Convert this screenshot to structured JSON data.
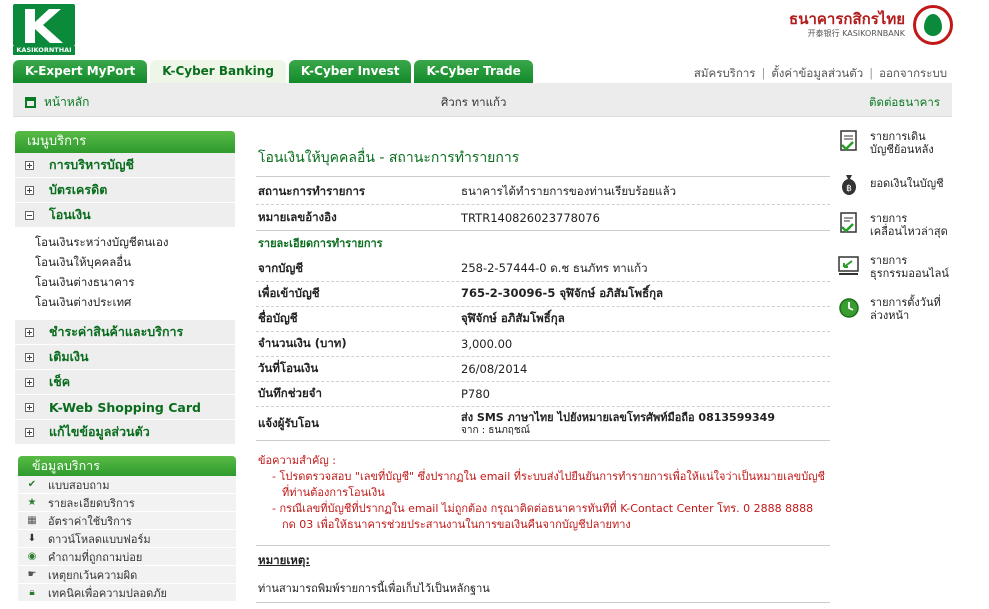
{
  "brand": {
    "logo_text": "KASIKORNTHAI",
    "bank_name_th": "ธนาคารกสิกรไทย",
    "bank_name_en": "开泰银行 KASIKORNBANK",
    "accent_green": "#0a8a3a",
    "accent_red": "#c21818"
  },
  "tabs": [
    {
      "label": "K-Expert MyPort"
    },
    {
      "label": "K-Cyber Banking"
    },
    {
      "label": "K-Cyber Invest"
    },
    {
      "label": "K-Cyber Trade"
    }
  ],
  "toplinks": {
    "register": "สมัครบริการ",
    "settings": "ตั้งค่าข้อมูลส่วนตัว",
    "logout": "ออกจากระบบ"
  },
  "subbar": {
    "home": "หน้าหลัก",
    "username": "ศิวกร ทาแก้ว",
    "contact": "ติดต่อธนาคาร"
  },
  "leftmenu": {
    "header": "เมนูบริการ",
    "items": [
      {
        "label": "การบริหารบัญชี"
      },
      {
        "label": "บัตรเครดิต"
      },
      {
        "label": "โอนเงิน"
      },
      {
        "label": "ชำระค่าสินค้าและบริการ"
      },
      {
        "label": "เติมเงิน"
      },
      {
        "label": "เช็ค"
      },
      {
        "label": "K-Web Shopping Card"
      },
      {
        "label": "แก้ไขข้อมูลส่วนตัว"
      }
    ],
    "transfer_sub": [
      "โอนเงินระหว่างบัญชีตนเอง",
      "โอนเงินให้บุคคลอื่น",
      "โอนเงินต่างธนาคาร",
      "โอนเงินต่างประเทศ"
    ]
  },
  "infobox": {
    "header": "ข้อมูลบริการ",
    "items": [
      {
        "label": "แบบสอบถาม",
        "icon": "checkmark-icon"
      },
      {
        "label": "รายละเอียดบริการ",
        "icon": "star-icon"
      },
      {
        "label": "อัตราค่าใช้บริการ",
        "icon": "calculator-icon"
      },
      {
        "label": "ดาวน์โหลดแบบฟอร์ม",
        "icon": "download-icon"
      },
      {
        "label": "คำถามที่ถูกถามบ่อย",
        "icon": "question-icon"
      },
      {
        "label": "เหตุยกเว้นความผิด",
        "icon": "hand-icon"
      },
      {
        "label": "เทคนิคเพื่อความปลอดภัย",
        "icon": "lock-icon"
      }
    ]
  },
  "main": {
    "title": "โอนเงินให้บุคคลอื่น - สถานะการทำรายการ",
    "status_label": "สถานะการทำรายการ",
    "status_value": "ธนาคารได้ทำรายการของท่านเรียบร้อยแล้ว",
    "ref_label": "หมายเลขอ้างอิง",
    "ref_value": "TRTR140826023778076",
    "detail_section": "รายละเอียดการทำรายการ",
    "from_label": "จากบัญชี",
    "from_value": "258-2-57444-0 ด.ช ธนภัทร ทาแก้ว",
    "to_label": "เพื่อเข้าบัญชี",
    "to_value": "765-2-30096-5 จุฬิจักษ์ อภิสัมโพธิ์กุล",
    "name_label": "ชื่อบัญชี",
    "name_value": "จุฬิจักษ์ อภิสัมโพธิ์กุล",
    "amount_label": "จำนวนเงิน (บาท)",
    "amount_value": "3,000.00",
    "date_label": "วันที่โอนเงิน",
    "date_value": "26/08/2014",
    "memo_label": "บันทึกช่วยจำ",
    "memo_value": "P780",
    "notify_label": "แจ้งผู้รับโอน",
    "notify_value1": "ส่ง SMS ภาษาไทย ไปยังหมายเลขโทรศัพท์มือถือ 0813599349",
    "notify_value2": "จาก : ธนภฤชณ์",
    "important_title": "ข้อความสำคัญ :",
    "important_1": "- โปรดตรวจสอบ \"เลขที่บัญชี\" ซึ่งปรากฏใน email ที่ระบบส่งไปยืนยันการทำรายการเพื่อให้แน่ใจว่าเป็นหมายเลขบัญชีที่ท่านต้องการโอนเงิน",
    "important_2": "- กรณีเลขที่บัญชีที่ปรากฏใน email ไม่ถูกต้อง กรุณาติดต่อธนาคารทันทีที่ K-Contact Center โทร. 0 2888 8888 กด 03 เพื่อให้ธนาคารช่วยประสานงานในการขอเงินคืนจากบัญชีปลายทาง",
    "remark_title": "หมายเหตุ:",
    "remark_text": "ท่านสามารถพิมพ์รายการนี้เพื่อเก็บไว้เป็นหลักฐาน"
  },
  "shortcuts": [
    {
      "line1": "รายการเดิน",
      "line2": "บัญชีย้อนหลัง",
      "icon": "statement-icon"
    },
    {
      "line1": "ยอดเงินในบัญชี",
      "line2": "",
      "icon": "money-bag-icon"
    },
    {
      "line1": "รายการ",
      "line2": "เคลื่อนไหวล่าสุด",
      "icon": "recent-transactions-icon"
    },
    {
      "line1": "รายการ",
      "line2": "ธุรกรรมออนไลน์",
      "icon": "online-transactions-icon"
    },
    {
      "line1": "รายการตั้งวันที่",
      "line2": "ล่วงหน้า",
      "icon": "clock-icon"
    }
  ]
}
